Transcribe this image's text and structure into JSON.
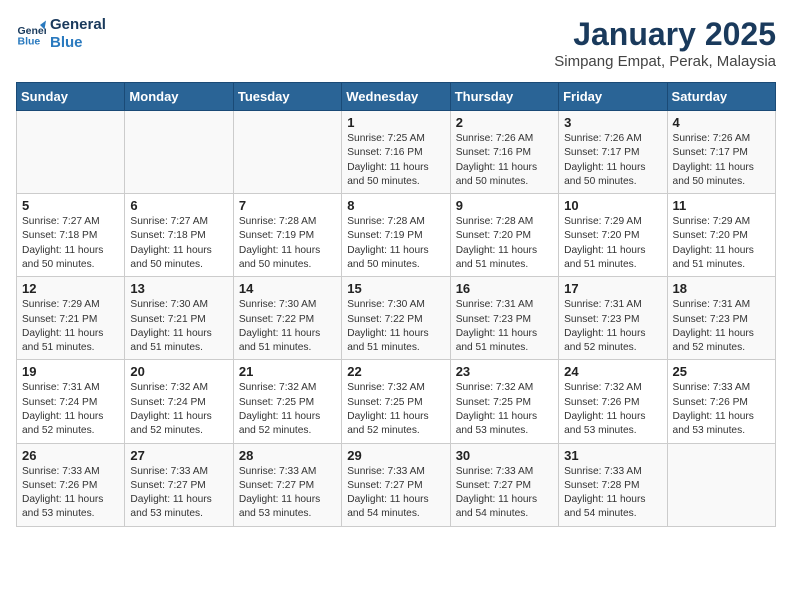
{
  "logo": {
    "line1": "General",
    "line2": "Blue"
  },
  "header": {
    "title": "January 2025",
    "subtitle": "Simpang Empat, Perak, Malaysia"
  },
  "weekdays": [
    "Sunday",
    "Monday",
    "Tuesday",
    "Wednesday",
    "Thursday",
    "Friday",
    "Saturday"
  ],
  "weeks": [
    [
      {
        "day": "",
        "text": ""
      },
      {
        "day": "",
        "text": ""
      },
      {
        "day": "",
        "text": ""
      },
      {
        "day": "1",
        "text": "Sunrise: 7:25 AM\nSunset: 7:16 PM\nDaylight: 11 hours\nand 50 minutes."
      },
      {
        "day": "2",
        "text": "Sunrise: 7:26 AM\nSunset: 7:16 PM\nDaylight: 11 hours\nand 50 minutes."
      },
      {
        "day": "3",
        "text": "Sunrise: 7:26 AM\nSunset: 7:17 PM\nDaylight: 11 hours\nand 50 minutes."
      },
      {
        "day": "4",
        "text": "Sunrise: 7:26 AM\nSunset: 7:17 PM\nDaylight: 11 hours\nand 50 minutes."
      }
    ],
    [
      {
        "day": "5",
        "text": "Sunrise: 7:27 AM\nSunset: 7:18 PM\nDaylight: 11 hours\nand 50 minutes."
      },
      {
        "day": "6",
        "text": "Sunrise: 7:27 AM\nSunset: 7:18 PM\nDaylight: 11 hours\nand 50 minutes."
      },
      {
        "day": "7",
        "text": "Sunrise: 7:28 AM\nSunset: 7:19 PM\nDaylight: 11 hours\nand 50 minutes."
      },
      {
        "day": "8",
        "text": "Sunrise: 7:28 AM\nSunset: 7:19 PM\nDaylight: 11 hours\nand 50 minutes."
      },
      {
        "day": "9",
        "text": "Sunrise: 7:28 AM\nSunset: 7:20 PM\nDaylight: 11 hours\nand 51 minutes."
      },
      {
        "day": "10",
        "text": "Sunrise: 7:29 AM\nSunset: 7:20 PM\nDaylight: 11 hours\nand 51 minutes."
      },
      {
        "day": "11",
        "text": "Sunrise: 7:29 AM\nSunset: 7:20 PM\nDaylight: 11 hours\nand 51 minutes."
      }
    ],
    [
      {
        "day": "12",
        "text": "Sunrise: 7:29 AM\nSunset: 7:21 PM\nDaylight: 11 hours\nand 51 minutes."
      },
      {
        "day": "13",
        "text": "Sunrise: 7:30 AM\nSunset: 7:21 PM\nDaylight: 11 hours\nand 51 minutes."
      },
      {
        "day": "14",
        "text": "Sunrise: 7:30 AM\nSunset: 7:22 PM\nDaylight: 11 hours\nand 51 minutes."
      },
      {
        "day": "15",
        "text": "Sunrise: 7:30 AM\nSunset: 7:22 PM\nDaylight: 11 hours\nand 51 minutes."
      },
      {
        "day": "16",
        "text": "Sunrise: 7:31 AM\nSunset: 7:23 PM\nDaylight: 11 hours\nand 51 minutes."
      },
      {
        "day": "17",
        "text": "Sunrise: 7:31 AM\nSunset: 7:23 PM\nDaylight: 11 hours\nand 52 minutes."
      },
      {
        "day": "18",
        "text": "Sunrise: 7:31 AM\nSunset: 7:23 PM\nDaylight: 11 hours\nand 52 minutes."
      }
    ],
    [
      {
        "day": "19",
        "text": "Sunrise: 7:31 AM\nSunset: 7:24 PM\nDaylight: 11 hours\nand 52 minutes."
      },
      {
        "day": "20",
        "text": "Sunrise: 7:32 AM\nSunset: 7:24 PM\nDaylight: 11 hours\nand 52 minutes."
      },
      {
        "day": "21",
        "text": "Sunrise: 7:32 AM\nSunset: 7:25 PM\nDaylight: 11 hours\nand 52 minutes."
      },
      {
        "day": "22",
        "text": "Sunrise: 7:32 AM\nSunset: 7:25 PM\nDaylight: 11 hours\nand 52 minutes."
      },
      {
        "day": "23",
        "text": "Sunrise: 7:32 AM\nSunset: 7:25 PM\nDaylight: 11 hours\nand 53 minutes."
      },
      {
        "day": "24",
        "text": "Sunrise: 7:32 AM\nSunset: 7:26 PM\nDaylight: 11 hours\nand 53 minutes."
      },
      {
        "day": "25",
        "text": "Sunrise: 7:33 AM\nSunset: 7:26 PM\nDaylight: 11 hours\nand 53 minutes."
      }
    ],
    [
      {
        "day": "26",
        "text": "Sunrise: 7:33 AM\nSunset: 7:26 PM\nDaylight: 11 hours\nand 53 minutes."
      },
      {
        "day": "27",
        "text": "Sunrise: 7:33 AM\nSunset: 7:27 PM\nDaylight: 11 hours\nand 53 minutes."
      },
      {
        "day": "28",
        "text": "Sunrise: 7:33 AM\nSunset: 7:27 PM\nDaylight: 11 hours\nand 53 minutes."
      },
      {
        "day": "29",
        "text": "Sunrise: 7:33 AM\nSunset: 7:27 PM\nDaylight: 11 hours\nand 54 minutes."
      },
      {
        "day": "30",
        "text": "Sunrise: 7:33 AM\nSunset: 7:27 PM\nDaylight: 11 hours\nand 54 minutes."
      },
      {
        "day": "31",
        "text": "Sunrise: 7:33 AM\nSunset: 7:28 PM\nDaylight: 11 hours\nand 54 minutes."
      },
      {
        "day": "",
        "text": ""
      }
    ]
  ]
}
